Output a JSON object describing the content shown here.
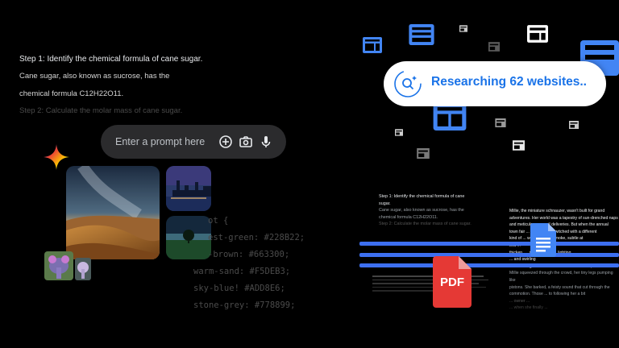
{
  "left": {
    "step1": "Step 1: Identify the chemical formula of cane sugar.",
    "line1": "Cane sugar, also known as sucrose, has the",
    "line2": "chemical formula C12H22O11.",
    "step2": "Step 2: Calculate the molar mass of cane sugar.",
    "prompt_placeholder": "Enter a prompt here",
    "code_lines": [
      "ot {",
      "est-green: #228B22;",
      "-brown:  #663300;",
      "warm-sand: #F5DEB3;",
      "sky-blue!  #ADD8E6;",
      "stone-grey: #778899;"
    ]
  },
  "right": {
    "research_label": "Researching 62 websites..",
    "doc_step1": "Step 1: Identify the chemical formula of cane",
    "doc_step1b": "sugar.",
    "doc_line1": "Cane sugar, also known as sucrose, has the",
    "doc_line2": "chemical formula C12H22O11.",
    "doc_step2": "Step 2: Calculate the molar mass of cane sugar.",
    "story_lines": [
      "Millie, the miniature schnauzer, wasn't built for grand",
      "adventures. Her world was a tapestry of sun-drenched naps",
      "and meticulous ... mail deliveries. But when the annual",
      "town fair ... Millie's nose twitched with a different",
      "kind of ... with a whiff of smoke, subtle at",
      "first ...",
      "thicken, ... mischief and ... lighting",
      "... and swirling",
      "... menacing black smoke. Without hesitation,",
      "Millie squeezed through the crowd, her tiny legs pumping like",
      "pistons. She barked, a feisty sound that cut through the",
      "commotion. Those ... to following her a bit",
      "... owner ...",
      "... when she finally ...",
      "..."
    ],
    "pdf_label": "PDF"
  },
  "colors": {
    "accent_blue": "#1a73e8",
    "pdf_red": "#e53935",
    "doc_blue": "#4285f4",
    "bar_blue": "#3d6ff0"
  }
}
